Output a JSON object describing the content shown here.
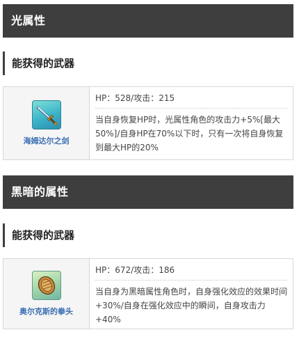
{
  "sections": [
    {
      "title": "光属性",
      "subheader": "能获得的武器",
      "weapon": {
        "icon": "sword-icon",
        "name": "海姆达尔之剑",
        "stats": "HP：528/攻击：215",
        "description": "当自身恢复HP时，光属性角色的攻击力+5%[最大50%]/自身HP在70%以下时，只有一次将自身恢复到最大HP的20%"
      }
    },
    {
      "title": "黑暗的属性",
      "subheader": "能获得的武器",
      "weapon": {
        "icon": "fist-icon",
        "name": "奥尔克斯的拳头",
        "stats": "HP：672/攻击：186",
        "description": "当自身为黑暗属性角色时，自身强化效应的效果时间+30%/自身在强化效应中的瞬间，自身攻击力+40%"
      }
    }
  ]
}
